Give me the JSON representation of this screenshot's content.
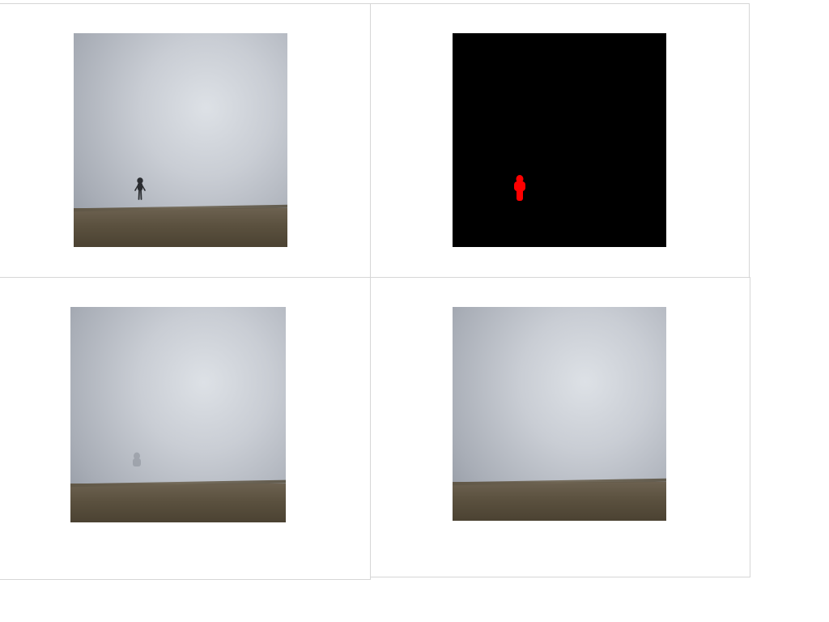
{
  "panels": [
    {
      "id": "panel-tl",
      "content": "original-photo",
      "description_icon": "person-jumping-over-field"
    },
    {
      "id": "panel-tr",
      "content": "segmentation-mask",
      "mask_color": "#ff0000",
      "background_color": "#000000"
    },
    {
      "id": "panel-bl",
      "content": "inpainted-photo-faint-remnant"
    },
    {
      "id": "panel-br",
      "content": "inpainted-photo-clean"
    }
  ],
  "colors": {
    "mask_fill": "#ff0000",
    "mask_background": "#000000",
    "sky": "#c9cdd4",
    "ground": "#5b513f",
    "figure": "#2a2c30"
  }
}
